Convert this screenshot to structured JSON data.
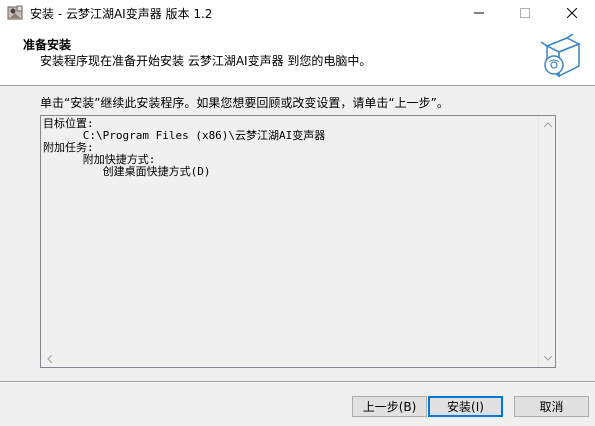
{
  "window": {
    "title": "安装 - 云梦江湖AI变声器 版本 1.2",
    "app_icon": "installer-app-icon",
    "controls": [
      "minimize-icon",
      "maximize-icon",
      "close-icon"
    ]
  },
  "header": {
    "title": "准备安装",
    "subtitle": "安装程序现在准备开始安装 云梦江湖AI变声器 到您的电脑中。",
    "graphic_icon": "installer-box-disc-icon"
  },
  "body": {
    "instruction": "单击“安装”继续此安装程序。如果您想要回顾或改变设置，请单击“上一步”。",
    "memo_lines": [
      "目标位置:",
      "      C:\\Program Files (x86)\\云梦江湖AI变声器",
      "",
      "附加任务:",
      "      附加快捷方式:",
      "         创建桌面快捷方式(D)"
    ]
  },
  "buttons": {
    "back": "上一步(B)",
    "install": "安装(I)",
    "cancel": "取消"
  }
}
